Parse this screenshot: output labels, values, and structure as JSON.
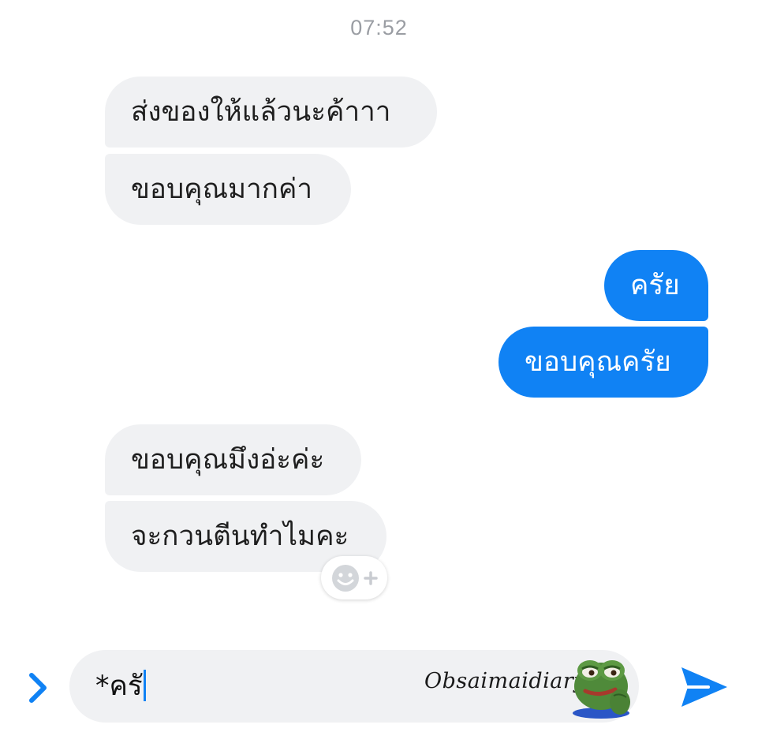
{
  "timestamp": "07:52",
  "messages": [
    {
      "direction": "incoming",
      "text": "ส่งของให้แล้วนะค้าาา"
    },
    {
      "direction": "incoming",
      "text": "ขอบคุณมากค่า"
    },
    {
      "direction": "outgoing",
      "text": "ครัย"
    },
    {
      "direction": "outgoing",
      "text": "ขอบคุณครัย"
    },
    {
      "direction": "incoming",
      "text": "ขอบคุณมึงอ่ะค่ะ"
    },
    {
      "direction": "incoming",
      "text": "จะกวนตีนทำไมคะ"
    }
  ],
  "composer": {
    "expand_icon": "chevron-right-icon",
    "input_value": "*ครั",
    "watermark": "Obsaimaidiary",
    "sticker": "pepe-frog-sticker",
    "send_icon": "send-arrow-icon"
  },
  "reaction_button": {
    "icon": "smiley-plus-icon"
  },
  "colors": {
    "accent": "#1082f4",
    "incoming_bubble": "#f0f1f3",
    "timestamp": "#9a9da3"
  }
}
